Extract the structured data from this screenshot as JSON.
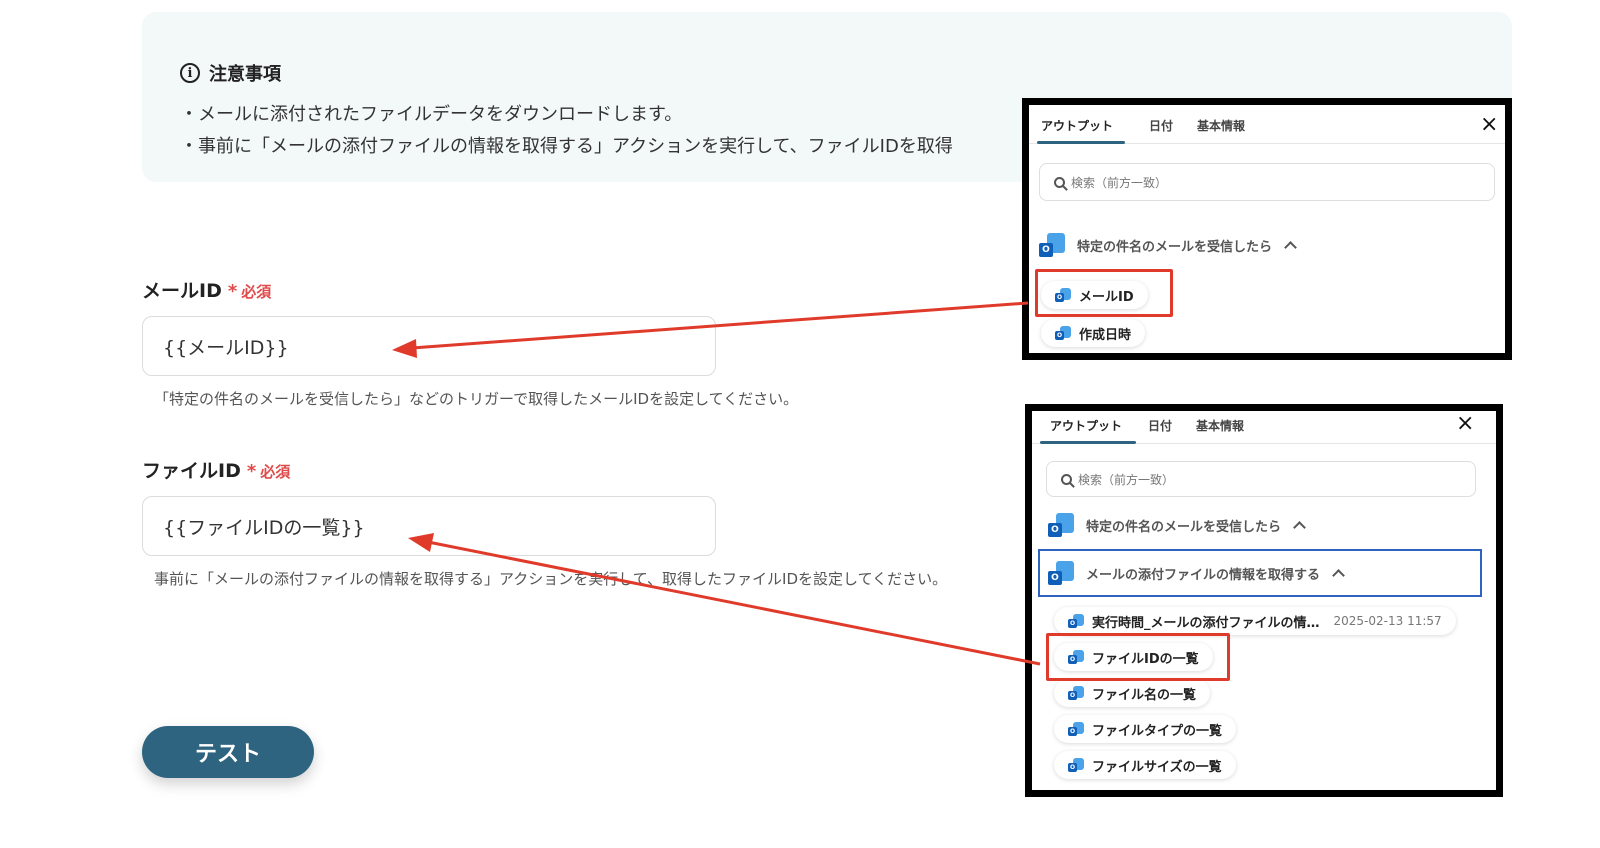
{
  "notice": {
    "title": "注意事項",
    "lines": [
      "・メールに添付されたファイルデータをダウンロードします。",
      "・事前に「メールの添付ファイルの情報を取得する」アクションを実行して、ファイルIDを取得"
    ]
  },
  "fields": [
    {
      "label": "メールID",
      "required_star": "*",
      "required_text": "必須",
      "value": "{{メールID}}",
      "help": "「特定の件名のメールを受信したら」などのトリガーで取得したメールIDを設定してください。"
    },
    {
      "label": "ファイルID",
      "required_star": "*",
      "required_text": "必須",
      "value": "{{ファイルIDの一覧}}",
      "help": "事前に「メールの添付ファイルの情報を取得する」アクションを実行して、取得したファイルIDを設定してください。"
    }
  ],
  "test_button": "テスト",
  "panel1": {
    "tabs": [
      "アウトプット",
      "日付",
      "基本情報"
    ],
    "close": "×",
    "search_placeholder": "検索（前方一致）",
    "group": "特定の件名のメールを受信したら",
    "items": [
      "メールID",
      "作成日時"
    ]
  },
  "panel2": {
    "tabs": [
      "アウトプット",
      "日付",
      "基本情報"
    ],
    "close": "×",
    "search_placeholder": "検索（前方一致）",
    "groups": [
      "特定の件名のメールを受信したら",
      "メールの添付ファイルの情報を取得する"
    ],
    "items": [
      {
        "label": "実行時間_メールの添付ファイルの情…",
        "timestamp": "2025-02-13 11:57"
      },
      {
        "label": "ファイルIDの一覧"
      },
      {
        "label": "ファイル名の一覧"
      },
      {
        "label": "ファイルタイプの一覧"
      },
      {
        "label": "ファイルサイズの一覧"
      }
    ]
  },
  "colors": {
    "accent": "#2f6480",
    "required": "#e04a4a",
    "annotation_red": "#e03a2a",
    "outlook_blue": "#0f5fb8"
  }
}
